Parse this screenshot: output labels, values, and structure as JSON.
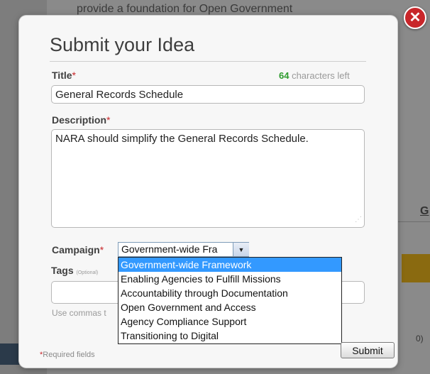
{
  "background": {
    "header_text": "provide a foundation for Open Government",
    "right_fragment": "G",
    "bottom_fragment": "0)"
  },
  "dialog": {
    "title": "Submit your Idea",
    "close_icon": "close-icon",
    "required_marker": "*",
    "title_field": {
      "label": "Title",
      "value": "General Records Schedule",
      "chars_left_count": "64",
      "chars_left_text": " characters left"
    },
    "description_field": {
      "label": "Description",
      "value": "NARA should simplify the General Records Schedule."
    },
    "campaign_field": {
      "label": "Campaign",
      "selected": "Government-wide Framework",
      "selected_visible": "Government-wide Fra",
      "options": [
        "Government-wide Framework",
        "Enabling Agencies to Fulfill Missions",
        "Accountability through Documentation",
        "Open Government and Access",
        "Agency Compliance Support",
        "Transitioning to Digital"
      ]
    },
    "tags_field": {
      "label": "Tags",
      "optional_note": "(Optional)",
      "value": "",
      "hint": "Use commas t"
    },
    "required_note": "Required fields",
    "submit_label": "Submit"
  },
  "colors": {
    "required": "#c8262a",
    "chars_left_count": "#2e9b2e",
    "dropdown_highlight": "#3399ff"
  }
}
